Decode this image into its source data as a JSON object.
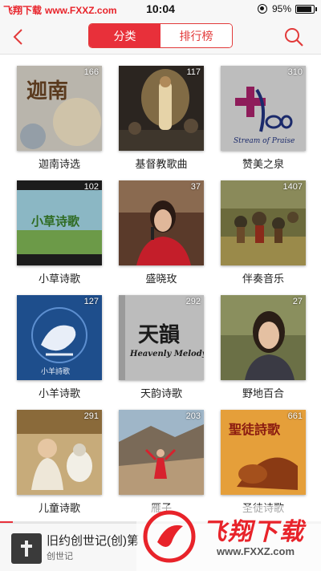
{
  "status_bar": {
    "watermark_left": "飞翔下载",
    "watermark_url": "www.FXXZ.com",
    "time": "10:04",
    "battery": "95%"
  },
  "nav": {
    "tabs": [
      {
        "label": "分类",
        "active": true
      },
      {
        "label": "排行榜",
        "active": false
      }
    ],
    "back_icon": "back-chevron-icon",
    "search_icon": "search-icon"
  },
  "categories": [
    {
      "name": "迦南诗选",
      "count": "166"
    },
    {
      "name": "基督教歌曲",
      "count": "117"
    },
    {
      "name": "赞美之泉",
      "count": "310"
    },
    {
      "name": "小草诗歌",
      "count": "102"
    },
    {
      "name": "盛晓玫",
      "count": "37"
    },
    {
      "name": "伴奏音乐",
      "count": "1407"
    },
    {
      "name": "小羊诗歌",
      "count": "127"
    },
    {
      "name": "天韵诗歌",
      "count": "292"
    },
    {
      "name": "野地百合",
      "count": "27"
    },
    {
      "name": "儿童诗歌",
      "count": "291"
    },
    {
      "name": "雁子",
      "count": "203"
    },
    {
      "name": "圣徒诗歌",
      "count": "661"
    }
  ],
  "cover_text": {
    "canaan": "迦南",
    "grass": "小草诗歌",
    "praise_sub": "Stream of Praise",
    "lamb": "小羊詩歌",
    "heavenly_cn": "天韻",
    "heavenly_en": "Heavenly Melody",
    "saints": "聖徒詩歌"
  },
  "player": {
    "title": "旧约创世记(创)第",
    "subtitle": "创世记",
    "progress": 0.04
  },
  "watermark_bottom": {
    "cn": "飞翔下载",
    "en": "www.FXXZ.com"
  },
  "colors": {
    "accent": "#e8303a",
    "watermark": "#e8232a"
  }
}
